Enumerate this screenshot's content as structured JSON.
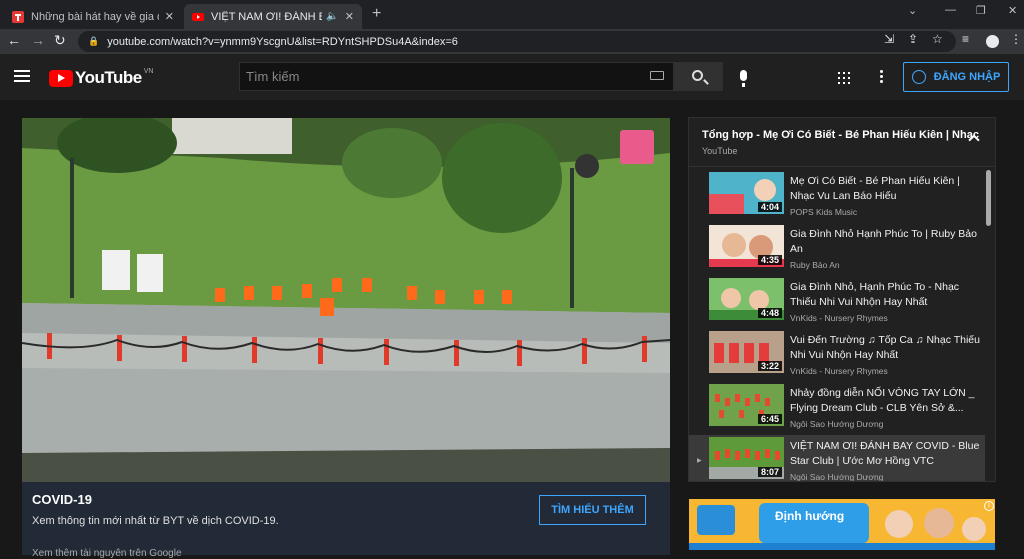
{
  "browser": {
    "tabs": [
      {
        "title": "Những bài hát hay về gia đình, c"
      },
      {
        "title": "VIỆT NAM ƠI! ĐÁNH BAY CO"
      }
    ],
    "url": "youtube.com/watch?v=ynmm9YscgnU&list=RDYntSHPDSu4A&index=6"
  },
  "masthead": {
    "logo_text": "YouTube",
    "country_code": "VN",
    "search_placeholder": "Tìm kiếm",
    "signin_label": "ĐĂNG NHẬP"
  },
  "covid_panel": {
    "title": "COVID-19",
    "text": "Xem thông tin mới nhất từ BYT về dịch COVID-19.",
    "button_label": "TÌM HIỂU THÊM",
    "link_text": "Xem thêm tài nguyên trên Google"
  },
  "playlist": {
    "title": "Tổng hợp - Mẹ Ơi Có Biết - Bé Phan Hiếu Kiên | Nhạc",
    "subtitle": "YouTube",
    "items": [
      {
        "title": "Mẹ Ơi Có Biết - Bé Phan Hiếu Kiên | Nhạc Vu Lan Báo Hiếu",
        "channel": "POPS Kids Music",
        "duration": "4:04"
      },
      {
        "title": "Gia Đình Nhỏ Hạnh Phúc To | Ruby Bảo An",
        "channel": "Ruby Bảo An",
        "duration": "4:35"
      },
      {
        "title": "Gia Đình Nhỏ, Hạnh Phúc To - Nhạc Thiếu Nhi Vui Nhộn Hay Nhất",
        "channel": "VnKids - Nursery Rhymes",
        "duration": "4:48"
      },
      {
        "title": "Vui Đến Trường ♫ Tốp Ca ♫ Nhạc Thiếu Nhi Vui Nhộn Hay Nhất",
        "channel": "VnKids - Nursery Rhymes",
        "duration": "3:22"
      },
      {
        "title": "Nhảy đồng diễn NỐI VÒNG TAY LỚN _ Flying Dream Club - CLB Yên Sở &...",
        "channel": "Ngôi Sao Hướng Dương",
        "duration": "6:45"
      },
      {
        "title": "VIỆT NAM ƠI! ĐÁNH BAY COVID - Blue Star Club | Ước Mơ Hồng VTC",
        "channel": "Ngôi Sao Hướng Dương",
        "duration": "8:07"
      }
    ]
  },
  "ad": {
    "text": "Định hướng"
  }
}
